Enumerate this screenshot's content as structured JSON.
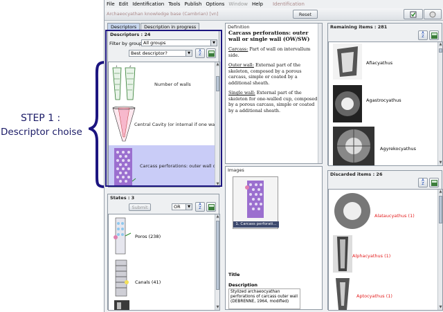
{
  "annotation": {
    "line1": "STEP 1 :",
    "line2": "Descriptor choise"
  },
  "menu": [
    "File",
    "Edit",
    "Identification",
    "Tools",
    "Publish",
    "Options",
    "Window",
    "Help"
  ],
  "window_title": "Identification",
  "kb_title": "Archaeocyathan knowledge base (Cambrian) [vn]",
  "reset_label": "Reset",
  "tabs": [
    "Descriptors",
    "Description in progress"
  ],
  "descriptors": {
    "title": "Descriptors : 24",
    "filter_label": "Filter by group",
    "filter_value": "All groups",
    "sort_value": "Best descriptor?",
    "items": [
      {
        "label": "Number of walls"
      },
      {
        "label": "Central Cavity (or internal if one wall)"
      },
      {
        "label": "Carcass perforations: outer wall or ..."
      }
    ]
  },
  "definition": {
    "title": "Definition",
    "heading": "Carcass perforations: outer wall or single wall (OW/SW)",
    "p1_term": "Carcass:",
    "p1_text": " Part of wall on intervallum side.",
    "p2_term": "Outer wall:",
    "p2_text": " External part of the skeleton, composed by a porous carcass, simple or coated by a additional sheath.",
    "p3_term": "Single wall:",
    "p3_text": " External part of the skeleton for one-walled cup, composed by a porous carcass, simple or coated by a additional sheath."
  },
  "images": {
    "title": "Images",
    "caption": "1. Carcass perforati...",
    "title_label": "Title",
    "description_label": "Description",
    "description_text": "Stylized archaeocyathan perforations of carcass outer wall (DEBRENNE, 1964, modified)"
  },
  "states": {
    "title": "States : 3",
    "submit_label": "Submit",
    "operator": "OR",
    "items": [
      {
        "label": "Poros (238)"
      },
      {
        "label": "Canals (41)"
      }
    ]
  },
  "remaining": {
    "title": "Remaining items : 281",
    "items": [
      {
        "label": "Afiacyathus"
      },
      {
        "label": "Agastrocyathus"
      },
      {
        "label": "Agyrekocyathus"
      }
    ]
  },
  "discarded": {
    "title": "Discarded items : 26",
    "items": [
      {
        "label": "Alataucyathus (1)"
      },
      {
        "label": "Alphacyathus (1)"
      },
      {
        "label": "Aptocyathus (1)"
      }
    ]
  },
  "colors": {
    "annotation": "#1c1580",
    "selected_row": "#c9ccf7",
    "discarded_text": "#e31b1b"
  }
}
